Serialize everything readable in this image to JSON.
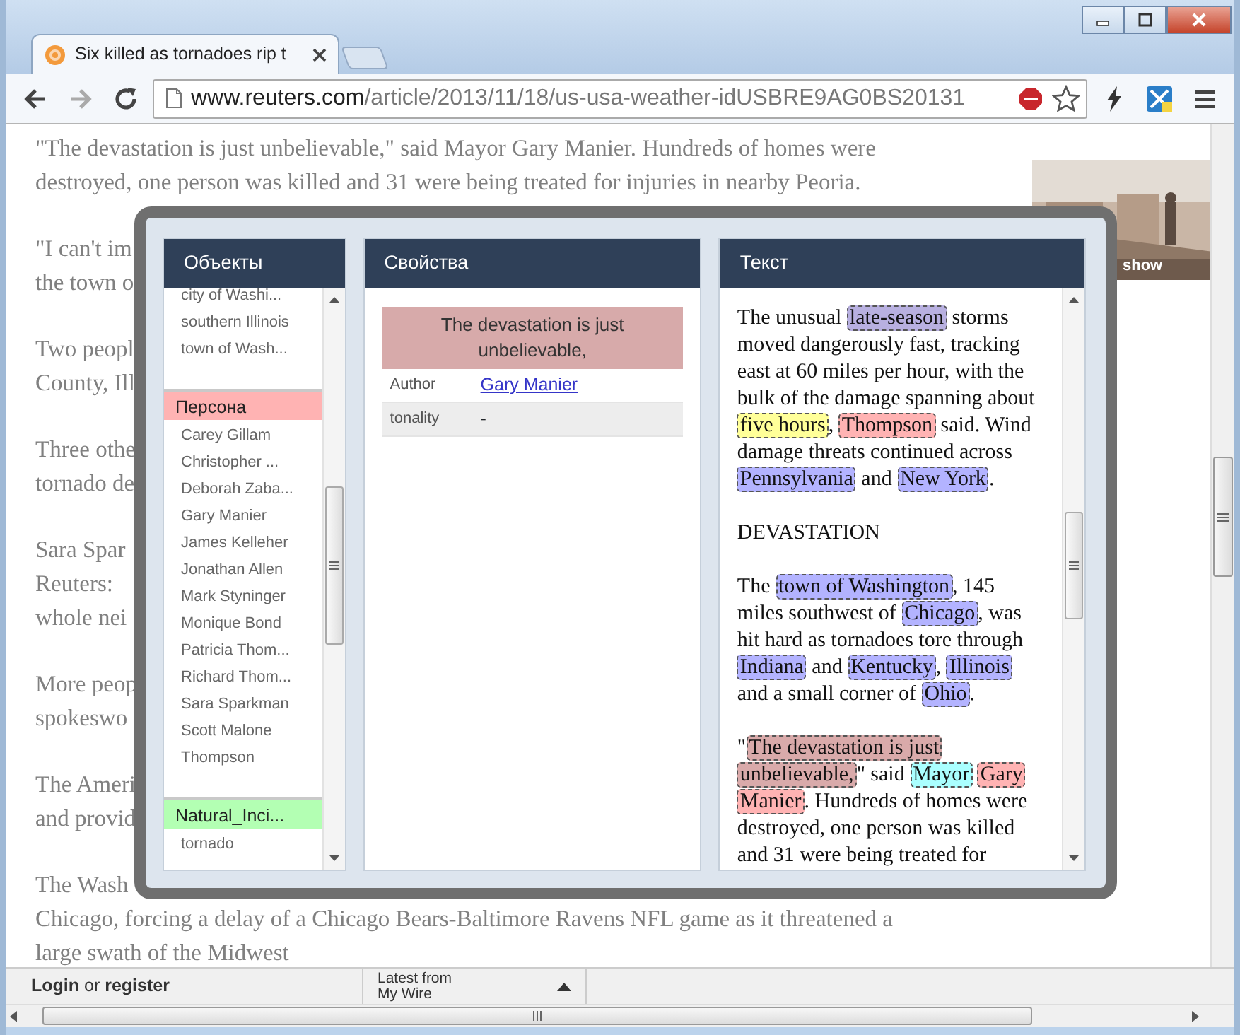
{
  "browser": {
    "tab_title": "Six killed as tornadoes rip t",
    "url_domain": "www.reuters.com",
    "url_path": "/article/2013/11/18/us-usa-weather-idUSBRE9AG0BS20131"
  },
  "article": {
    "paragraphs": [
      [
        "\"The devastation is just unbelievable,\" said Mayor Gary Manier. Hundreds of homes were",
        "destroyed, one person was killed and 31 were being treated for injuries in nearby Peoria."
      ],
      [
        "\"I can't im",
        "the town o"
      ],
      [
        "Two peopl",
        "County, Ill"
      ],
      [
        "Three othe",
        "tornado de"
      ],
      [
        "Sara Spar",
        "Reuters:",
        "whole nei"
      ],
      [
        "More peop",
        "spokeswo"
      ],
      [
        "The Ameri",
        "and provid"
      ],
      [
        "The Wash",
        "Chicago, forcing a delay of a Chicago Bears-Baltimore Ravens NFL game as it threatened a",
        "large swath of the Midwest"
      ]
    ]
  },
  "photo": {
    "kind": "picture",
    "caption": "show"
  },
  "annotator": {
    "objects": {
      "title": "Объекты",
      "items": [
        {
          "kind": "item",
          "text": "city of Washi..."
        },
        {
          "kind": "item",
          "text": "southern Illinois"
        },
        {
          "kind": "item",
          "text": "town of Wash..."
        },
        {
          "kind": "group",
          "text": "Персона",
          "color": "#ffb3b3"
        },
        {
          "kind": "item",
          "text": "Carey Gillam"
        },
        {
          "kind": "item",
          "text": "Christopher ..."
        },
        {
          "kind": "item",
          "text": "Deborah Zaba..."
        },
        {
          "kind": "item",
          "text": "Gary Manier"
        },
        {
          "kind": "item",
          "text": "James Kelleher"
        },
        {
          "kind": "item",
          "text": "Jonathan Allen"
        },
        {
          "kind": "item",
          "text": "Mark Styninger"
        },
        {
          "kind": "item",
          "text": "Monique Bond"
        },
        {
          "kind": "item",
          "text": "Patricia Thom..."
        },
        {
          "kind": "item",
          "text": "Richard Thom..."
        },
        {
          "kind": "item",
          "text": "Sara Sparkman"
        },
        {
          "kind": "item",
          "text": "Scott Malone"
        },
        {
          "kind": "item",
          "text": "Thompson"
        },
        {
          "kind": "group",
          "text": "Natural_Inci...",
          "color": "#b3ffb3"
        },
        {
          "kind": "item",
          "text": "tornado"
        }
      ]
    },
    "properties": {
      "title": "Свойства",
      "quote": "The devastation is just unbelievable,",
      "rows": [
        {
          "label": "Author",
          "value": "Gary Manier",
          "kind": "link"
        },
        {
          "label": "tonality",
          "value": "-",
          "kind": "plain"
        }
      ]
    },
    "text": {
      "title": "Текст",
      "paragraphs": [
        [
          {
            "text": "The unusual "
          },
          {
            "text": "late-season",
            "color": "#b8b0e0"
          },
          {
            "text": " storms moved dangerously fast, tracking east at 60 miles per hour, with the bulk of the damage spanning about "
          },
          {
            "text": "five hours",
            "color": "#ffff99"
          },
          {
            "text": ", "
          },
          {
            "text": "Thompson",
            "color": "#ffb3b3"
          },
          {
            "text": " said. Wind damage threats continued across "
          },
          {
            "text": "Pennsylvania",
            "color": "#b3b3ff"
          },
          {
            "text": " and "
          },
          {
            "text": "New York",
            "color": "#b3b3ff"
          },
          {
            "text": "."
          }
        ],
        [
          {
            "text": "DEVASTATION"
          }
        ],
        [
          {
            "text": "The "
          },
          {
            "text": "town of Washington",
            "color": "#b3b3ff"
          },
          {
            "text": ", 145 miles southwest of "
          },
          {
            "text": "Chicago",
            "color": "#b3b3ff"
          },
          {
            "text": ", was hit hard as tornadoes tore through "
          },
          {
            "text": "Indiana",
            "color": "#b3b3ff"
          },
          {
            "text": " and "
          },
          {
            "text": "Kentucky",
            "color": "#b3b3ff"
          },
          {
            "text": ", "
          },
          {
            "text": "Illinois",
            "color": "#b3b3ff"
          },
          {
            "text": " and a small corner of "
          },
          {
            "text": "Ohio",
            "color": "#b3b3ff"
          },
          {
            "text": "."
          }
        ],
        [
          {
            "text": "\""
          },
          {
            "text": "The devastation is just",
            "color": "#d9aaaa"
          },
          {
            "text": "unbelievable,",
            "color": "#d9aaaa"
          },
          {
            "text": "\" said "
          },
          {
            "text": "Mayor",
            "color": "#aaffff"
          },
          {
            "text": "Gary",
            "color": "#ffb3b3"
          },
          {
            "text": "Manier",
            "color": "#ffb3b3"
          },
          {
            "text": ". Hundreds of homes were destroyed, one person was killed and 31 were being treated for"
          }
        ]
      ]
    }
  },
  "footer": {
    "login": "**Login** or **register**",
    "latest": [
      "Latest from",
      "My Wire"
    ]
  }
}
